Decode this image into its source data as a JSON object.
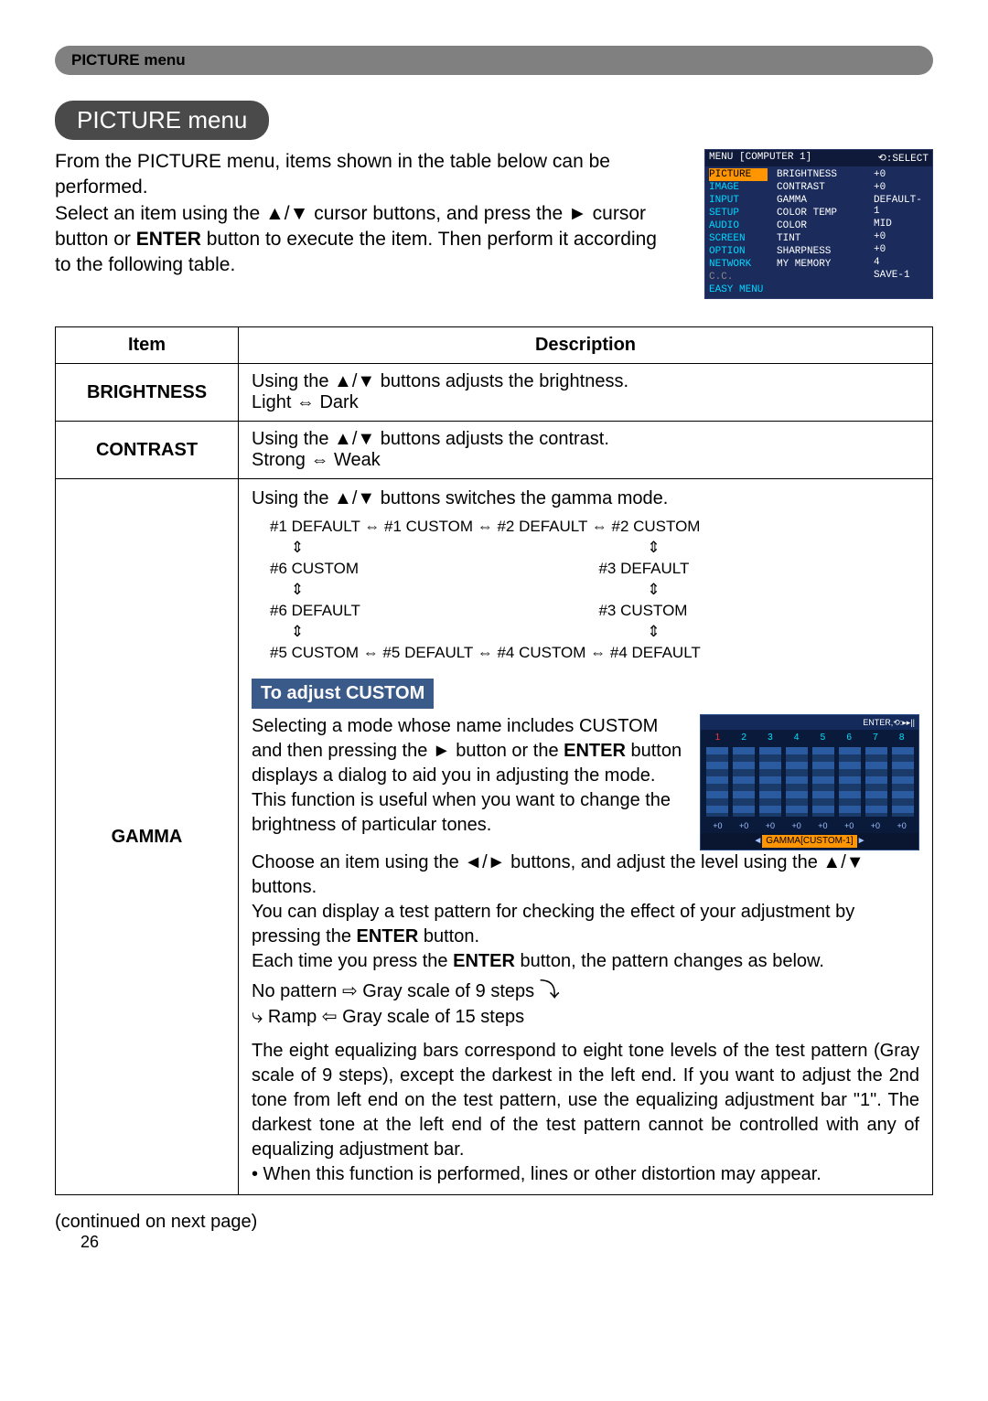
{
  "section_tag": "PICTURE menu",
  "title": "PICTURE menu",
  "intro": "From the PICTURE menu, items shown in the table below can be performed.\nSelect an item using the ▲/▼ cursor buttons, and press the ► cursor button or ENTER button to execute the item. Then perform it according to the following table.",
  "menu_preview": {
    "header_left": "MENU [COMPUTER 1]",
    "header_right": "⟲:SELECT",
    "left_items": [
      "PICTURE",
      "IMAGE",
      "INPUT",
      "SETUP",
      "AUDIO",
      "SCREEN",
      "OPTION",
      "NETWORK",
      "C.C.",
      "EASY MENU"
    ],
    "mid_items": [
      "BRIGHTNESS",
      "CONTRAST",
      "GAMMA",
      "COLOR TEMP",
      "COLOR",
      "TINT",
      "SHARPNESS",
      "MY MEMORY"
    ],
    "right_items": [
      "+0",
      "+0",
      "DEFAULT-1",
      "MID",
      "+0",
      "+0",
      "4",
      "SAVE-1"
    ]
  },
  "table": {
    "head_item": "Item",
    "head_desc": "Description",
    "brightness": {
      "label": "BRIGHTNESS",
      "desc": "Using the ▲/▼ buttons adjusts the brightness.\nLight ⇔ Dark"
    },
    "contrast": {
      "label": "CONTRAST",
      "desc": "Using the ▲/▼ buttons adjusts the contrast.\nStrong ⇔ Weak"
    },
    "gamma": {
      "label": "GAMMA",
      "line1": "Using the ▲/▼ buttons switches the gamma mode.",
      "diag_top": "#1 DEFAULT ⇔ #1 CUSTOM ⇔ #2 DEFAULT ⇔ #2 CUSTOM",
      "diag_l1": "#6 CUSTOM",
      "diag_r1": "#3 DEFAULT",
      "diag_l2": "#6 DEFAULT",
      "diag_r2": "#3 CUSTOM",
      "diag_bottom": "#5 CUSTOM ⇔ #5 DEFAULT ⇔ #4 CUSTOM ⇔ #4 DEFAULT",
      "sub_header": "To adjust CUSTOM",
      "custom_p1": "Selecting a mode whose name includes CUSTOM and then pressing the ► button or the ENTER button displays a dialog to aid you in adjusting the mode.\nThis function is useful when you want to change the brightness of particular tones.",
      "custom_p2": "Choose an item using the ◄/► buttons, and adjust the level using the ▲/▼ buttons.",
      "custom_p3": "You can display a test pattern for checking the effect of your adjustment by pressing the ENTER button.\nEach time you press the ENTER button, the pattern changes as below.",
      "loop1": "No pattern ⇨ Gray scale of 9 steps",
      "loop2": "Ramp ⇦ Gray scale of 15 steps",
      "custom_p4": "The eight equalizing bars correspond to eight tone levels of the test pattern (Gray scale of 9 steps), except the darkest in the left end. If you want to adjust the 2nd tone from left end on the test pattern, use the equalizing adjustment bar \"1\". The darkest tone at the left end of the test pattern cannot be controlled with any of equalizing adjustment bar.",
      "custom_bullet": "• When this function is performed, lines or other distortion may appear.",
      "eq": {
        "header_left": "",
        "header_right": "ENTER,⟲:▸▸||",
        "nums": [
          "1",
          "2",
          "3",
          "4",
          "5",
          "6",
          "7",
          "8"
        ],
        "vals": [
          "+0",
          "+0",
          "+0",
          "+0",
          "+0",
          "+0",
          "+0",
          "+0"
        ],
        "footer": "GAMMA[CUSTOM-1]"
      }
    }
  },
  "continued": "(continued on next page)",
  "page_number": "26"
}
